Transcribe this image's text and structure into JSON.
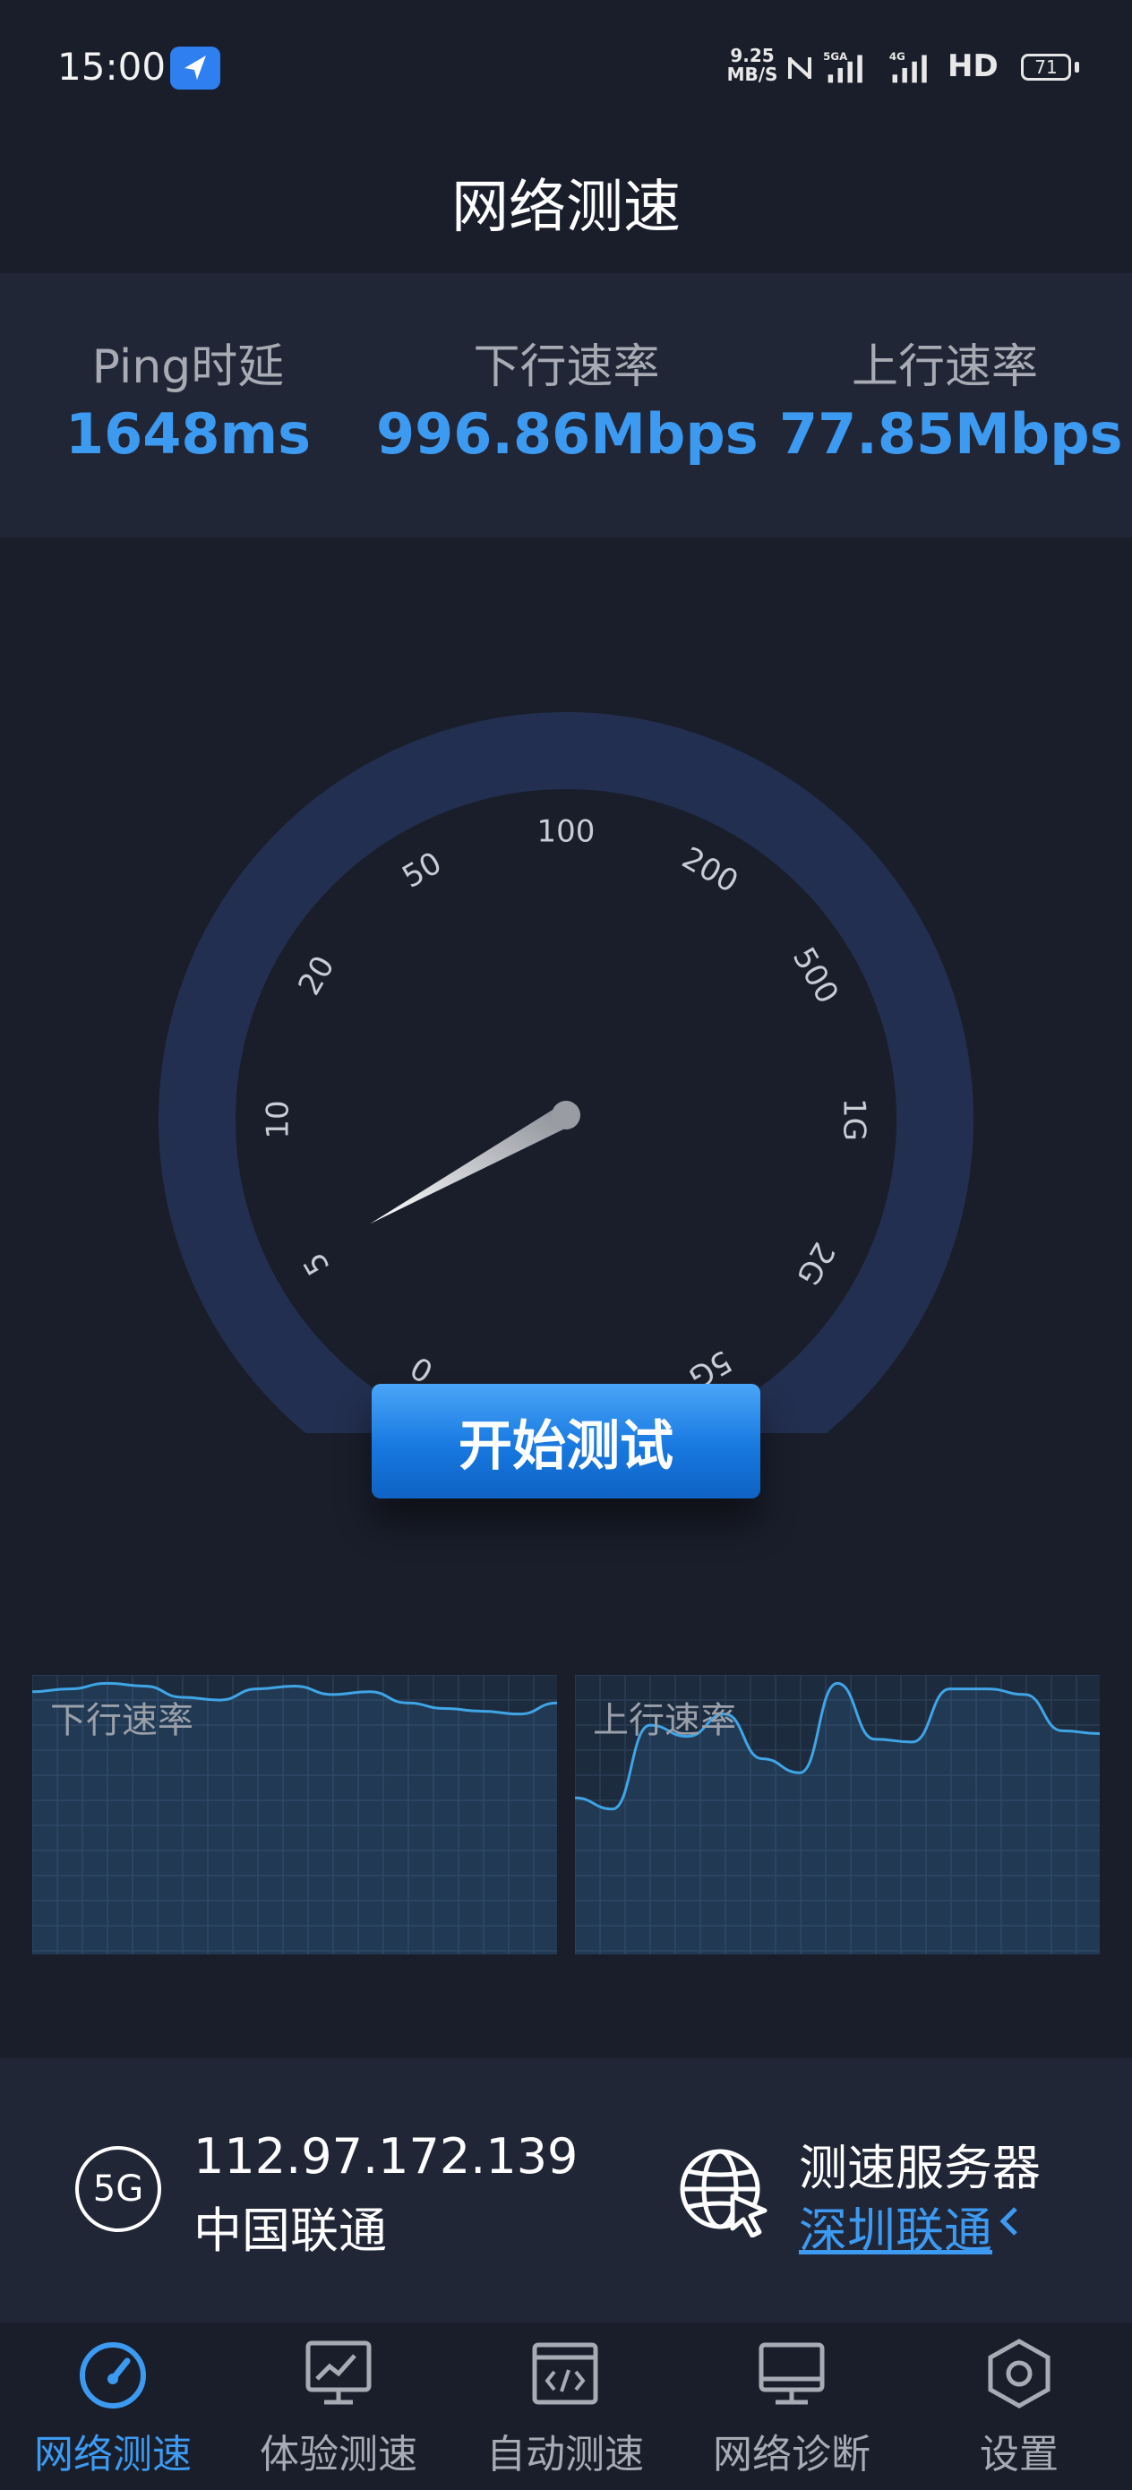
{
  "status_bar": {
    "time": "15:00",
    "net_speed_value": "9.25",
    "net_speed_unit": "MB/S",
    "sim1_tag": "5GA",
    "sim2_tag": "4G",
    "hd_label": "HD",
    "battery": "71"
  },
  "header": {
    "title": "网络测速"
  },
  "stats": {
    "ping": {
      "label": "Ping时延",
      "value": "1648ms"
    },
    "download": {
      "label": "下行速率",
      "value": "996.86Mbps"
    },
    "upload": {
      "label": "上行速率",
      "value": "77.85Mbps"
    }
  },
  "gauge": {
    "ticks": [
      "0",
      "5",
      "10",
      "20",
      "50",
      "100",
      "200",
      "500",
      "1G",
      "2G",
      "5G"
    ],
    "needle_value": "5",
    "colors": {
      "track": "#232f50",
      "tick_text": "#c9ccd4"
    }
  },
  "start_button": {
    "label": "开始测试"
  },
  "charts": {
    "download": {
      "label": "下行速率",
      "line_color": "#3fa5e6",
      "values": [
        0.94,
        0.95,
        0.97,
        0.96,
        0.92,
        0.91,
        0.95,
        0.96,
        0.93,
        0.94,
        0.9,
        0.88,
        0.87,
        0.86,
        0.9
      ]
    },
    "upload": {
      "label": "上行速率",
      "line_color": "#3fa5e6",
      "values": [
        0.56,
        0.52,
        0.82,
        0.78,
        0.86,
        0.7,
        0.65,
        0.97,
        0.77,
        0.76,
        0.95,
        0.95,
        0.93,
        0.8,
        0.79
      ]
    }
  },
  "server_info": {
    "network_type": "5G",
    "ip": "112.97.172.139",
    "carrier": "中国联通",
    "server_label": "测速服务器",
    "server_name": "深圳联通"
  },
  "bottom_nav": [
    {
      "label": "网络测速",
      "icon": "speedometer-icon",
      "active": true
    },
    {
      "label": "体验测速",
      "icon": "chart-monitor-icon",
      "active": false
    },
    {
      "label": "自动测速",
      "icon": "code-window-icon",
      "active": false
    },
    {
      "label": "网络诊断",
      "icon": "monitor-icon",
      "active": false
    },
    {
      "label": "设置",
      "icon": "settings-hexagon-icon",
      "active": false
    }
  ]
}
